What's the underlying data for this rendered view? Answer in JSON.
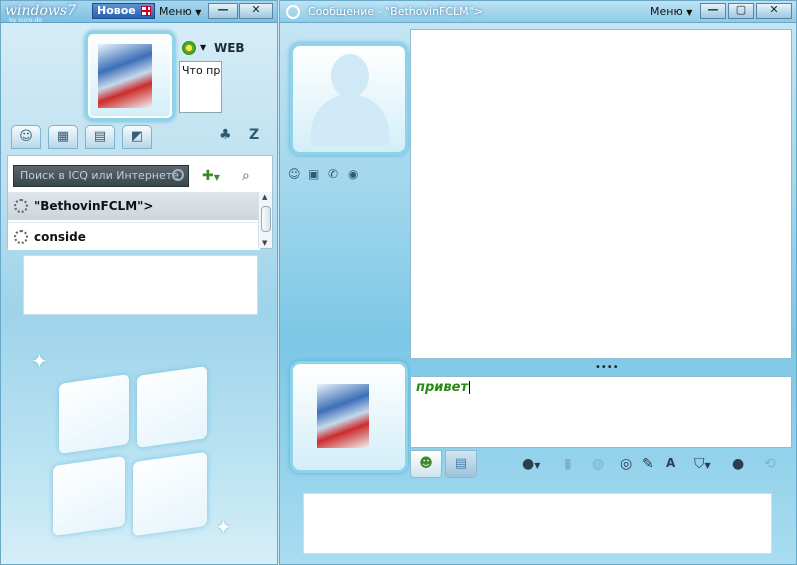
{
  "contact_window": {
    "logo_text": "windows7",
    "logo_sub": "by xuce.de",
    "new_button": "Новое",
    "menu_label": "Меню",
    "minimize": "—",
    "close": "✕",
    "status_network": "WEB",
    "status_message": "Что происходит се",
    "search_placeholder": "Поиск в ICQ или Интернете",
    "contacts": [
      {
        "name": "\"BethovinFCLM\">"
      },
      {
        "name": "conside"
      }
    ],
    "scroll_up": "▲",
    "scroll_down": "▼"
  },
  "message_window": {
    "title": "Сообщение - \"BethovinFCLM\">",
    "menu_label": "Меню",
    "minimize": "—",
    "maximize": "▢",
    "close": "✕",
    "splitter": "••••",
    "input_text": "привет"
  },
  "icons": {
    "tabs": [
      "contacts-tab-icon",
      "groups-tab-icon",
      "history-tab-icon",
      "chats-tab-icon"
    ],
    "toolbar": [
      "smileys-icon",
      "send-file-icon",
      "web-icon",
      "webcam-icon",
      "font-icon",
      "security-icon",
      "sound-icon",
      "more-icon"
    ]
  },
  "colors": {
    "accent": "#2a5fae",
    "typed_text": "#2a8a1a",
    "window_bg": "#9fd6ec"
  }
}
